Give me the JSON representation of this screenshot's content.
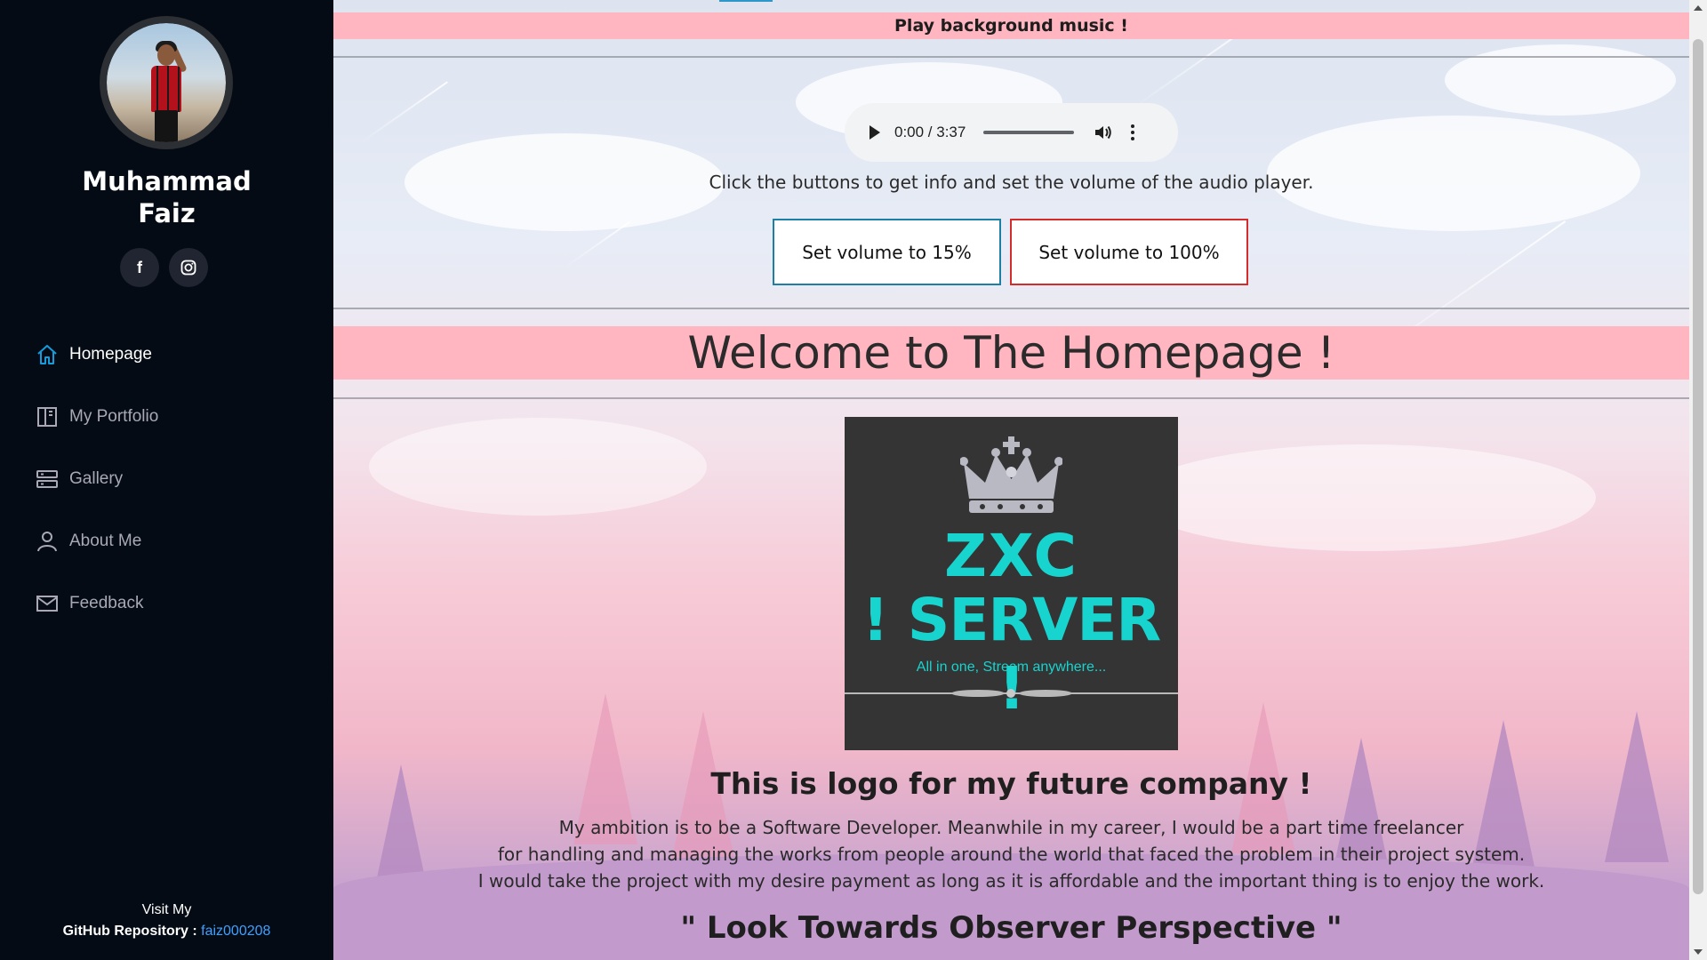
{
  "sidebar": {
    "profile_name_line1": "Muhammad",
    "profile_name_line2": "Faiz",
    "social": [
      {
        "icon": "facebook-icon",
        "glyph": "f"
      },
      {
        "icon": "instagram-icon",
        "glyph": "◎"
      }
    ],
    "nav": [
      {
        "label": "Homepage",
        "icon": "home-icon",
        "active": true
      },
      {
        "label": "My Portfolio",
        "icon": "portfolio-icon",
        "active": false
      },
      {
        "label": "Gallery",
        "icon": "gallery-icon",
        "active": false
      },
      {
        "label": "About Me",
        "icon": "user-icon",
        "active": false
      },
      {
        "label": "Feedback",
        "icon": "envelope-icon",
        "active": false
      }
    ],
    "footer": {
      "line1": "Visit My",
      "label": "GitHub Repository : ",
      "link": "faiz000208"
    },
    "colors": {
      "background": "#040b14",
      "active_icon": "#149ddd",
      "link": "#3fa0ff"
    }
  },
  "main": {
    "music_banner": "Play background music !",
    "player": {
      "time": "0:00 / 3:37"
    },
    "instructions": "Click the buttons to get info and set the volume of the audio player.",
    "buttons": {
      "volume_low": "Set volume to 15%",
      "volume_high": "Set volume to 100%"
    },
    "welcome": "Welcome to The Homepage !",
    "logo": {
      "title": "ZXC",
      "subtitle": "! SERVER !",
      "tagline": "All in one, Stream anywhere...",
      "icon": "crown-icon"
    },
    "logo_caption": "This is logo for my future company !",
    "ambition": [
      "My ambition is to be a Software Developer. Meanwhile in my career, I would be a part time freelancer",
      "for handling and managing the works from people around the world that faced the problem in their project system.",
      "I would take the project with my desire payment as long as it is affordable and the important thing is to enjoy the work."
    ],
    "quote": "\" Look Towards Observer Perspective \"",
    "colors": {
      "banner": "#ffb6c1",
      "logo_bg": "#343434",
      "logo_text": "#18d4cf",
      "btn_low_border": "#1c7fa6",
      "btn_high_border": "#d42b2b"
    }
  }
}
